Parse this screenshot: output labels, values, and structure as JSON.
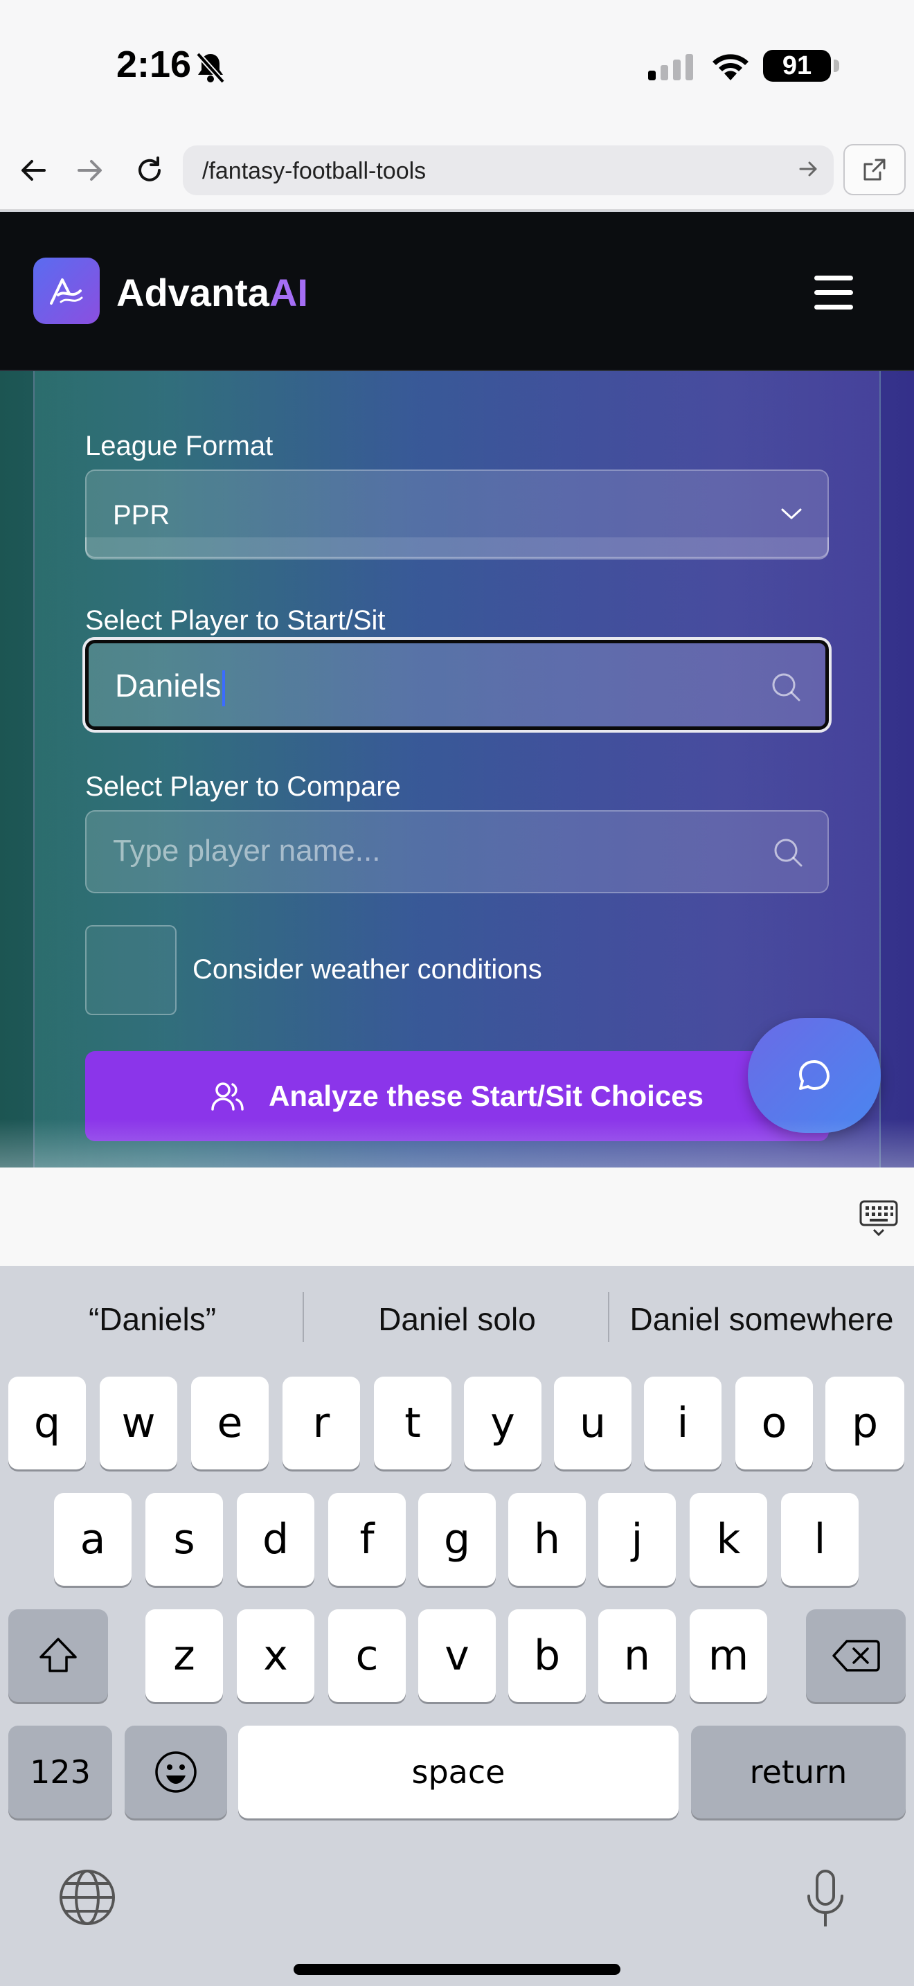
{
  "status": {
    "time": "2:16",
    "battery": "91"
  },
  "browser": {
    "url": "/fantasy-football-tools"
  },
  "site": {
    "brand_main": "Advanta",
    "brand_accent": "AI"
  },
  "form": {
    "league_format_label": "League Format",
    "league_format_value": "PPR",
    "start_sit_label": "Select Player to Start/Sit",
    "start_sit_value": "Daniels",
    "compare_label": "Select Player to Compare",
    "compare_placeholder": "Type player name...",
    "weather_label": "Consider weather conditions",
    "analyze_button": "Analyze these Start/Sit Choices"
  },
  "keyboard": {
    "suggestions": [
      "“Daniels”",
      "Daniel solo",
      "Daniel somewhere"
    ],
    "row1": [
      "q",
      "w",
      "e",
      "r",
      "t",
      "y",
      "u",
      "i",
      "o",
      "p"
    ],
    "row2": [
      "a",
      "s",
      "d",
      "f",
      "g",
      "h",
      "j",
      "k",
      "l"
    ],
    "row3": [
      "z",
      "x",
      "c",
      "v",
      "b",
      "n",
      "m"
    ],
    "numbers_key": "123",
    "space_key": "space",
    "return_key": "return"
  },
  "colors": {
    "accent_purple": "#8b35ea",
    "brand_ai": "#a56ef5",
    "caret": "#3b6cff"
  }
}
